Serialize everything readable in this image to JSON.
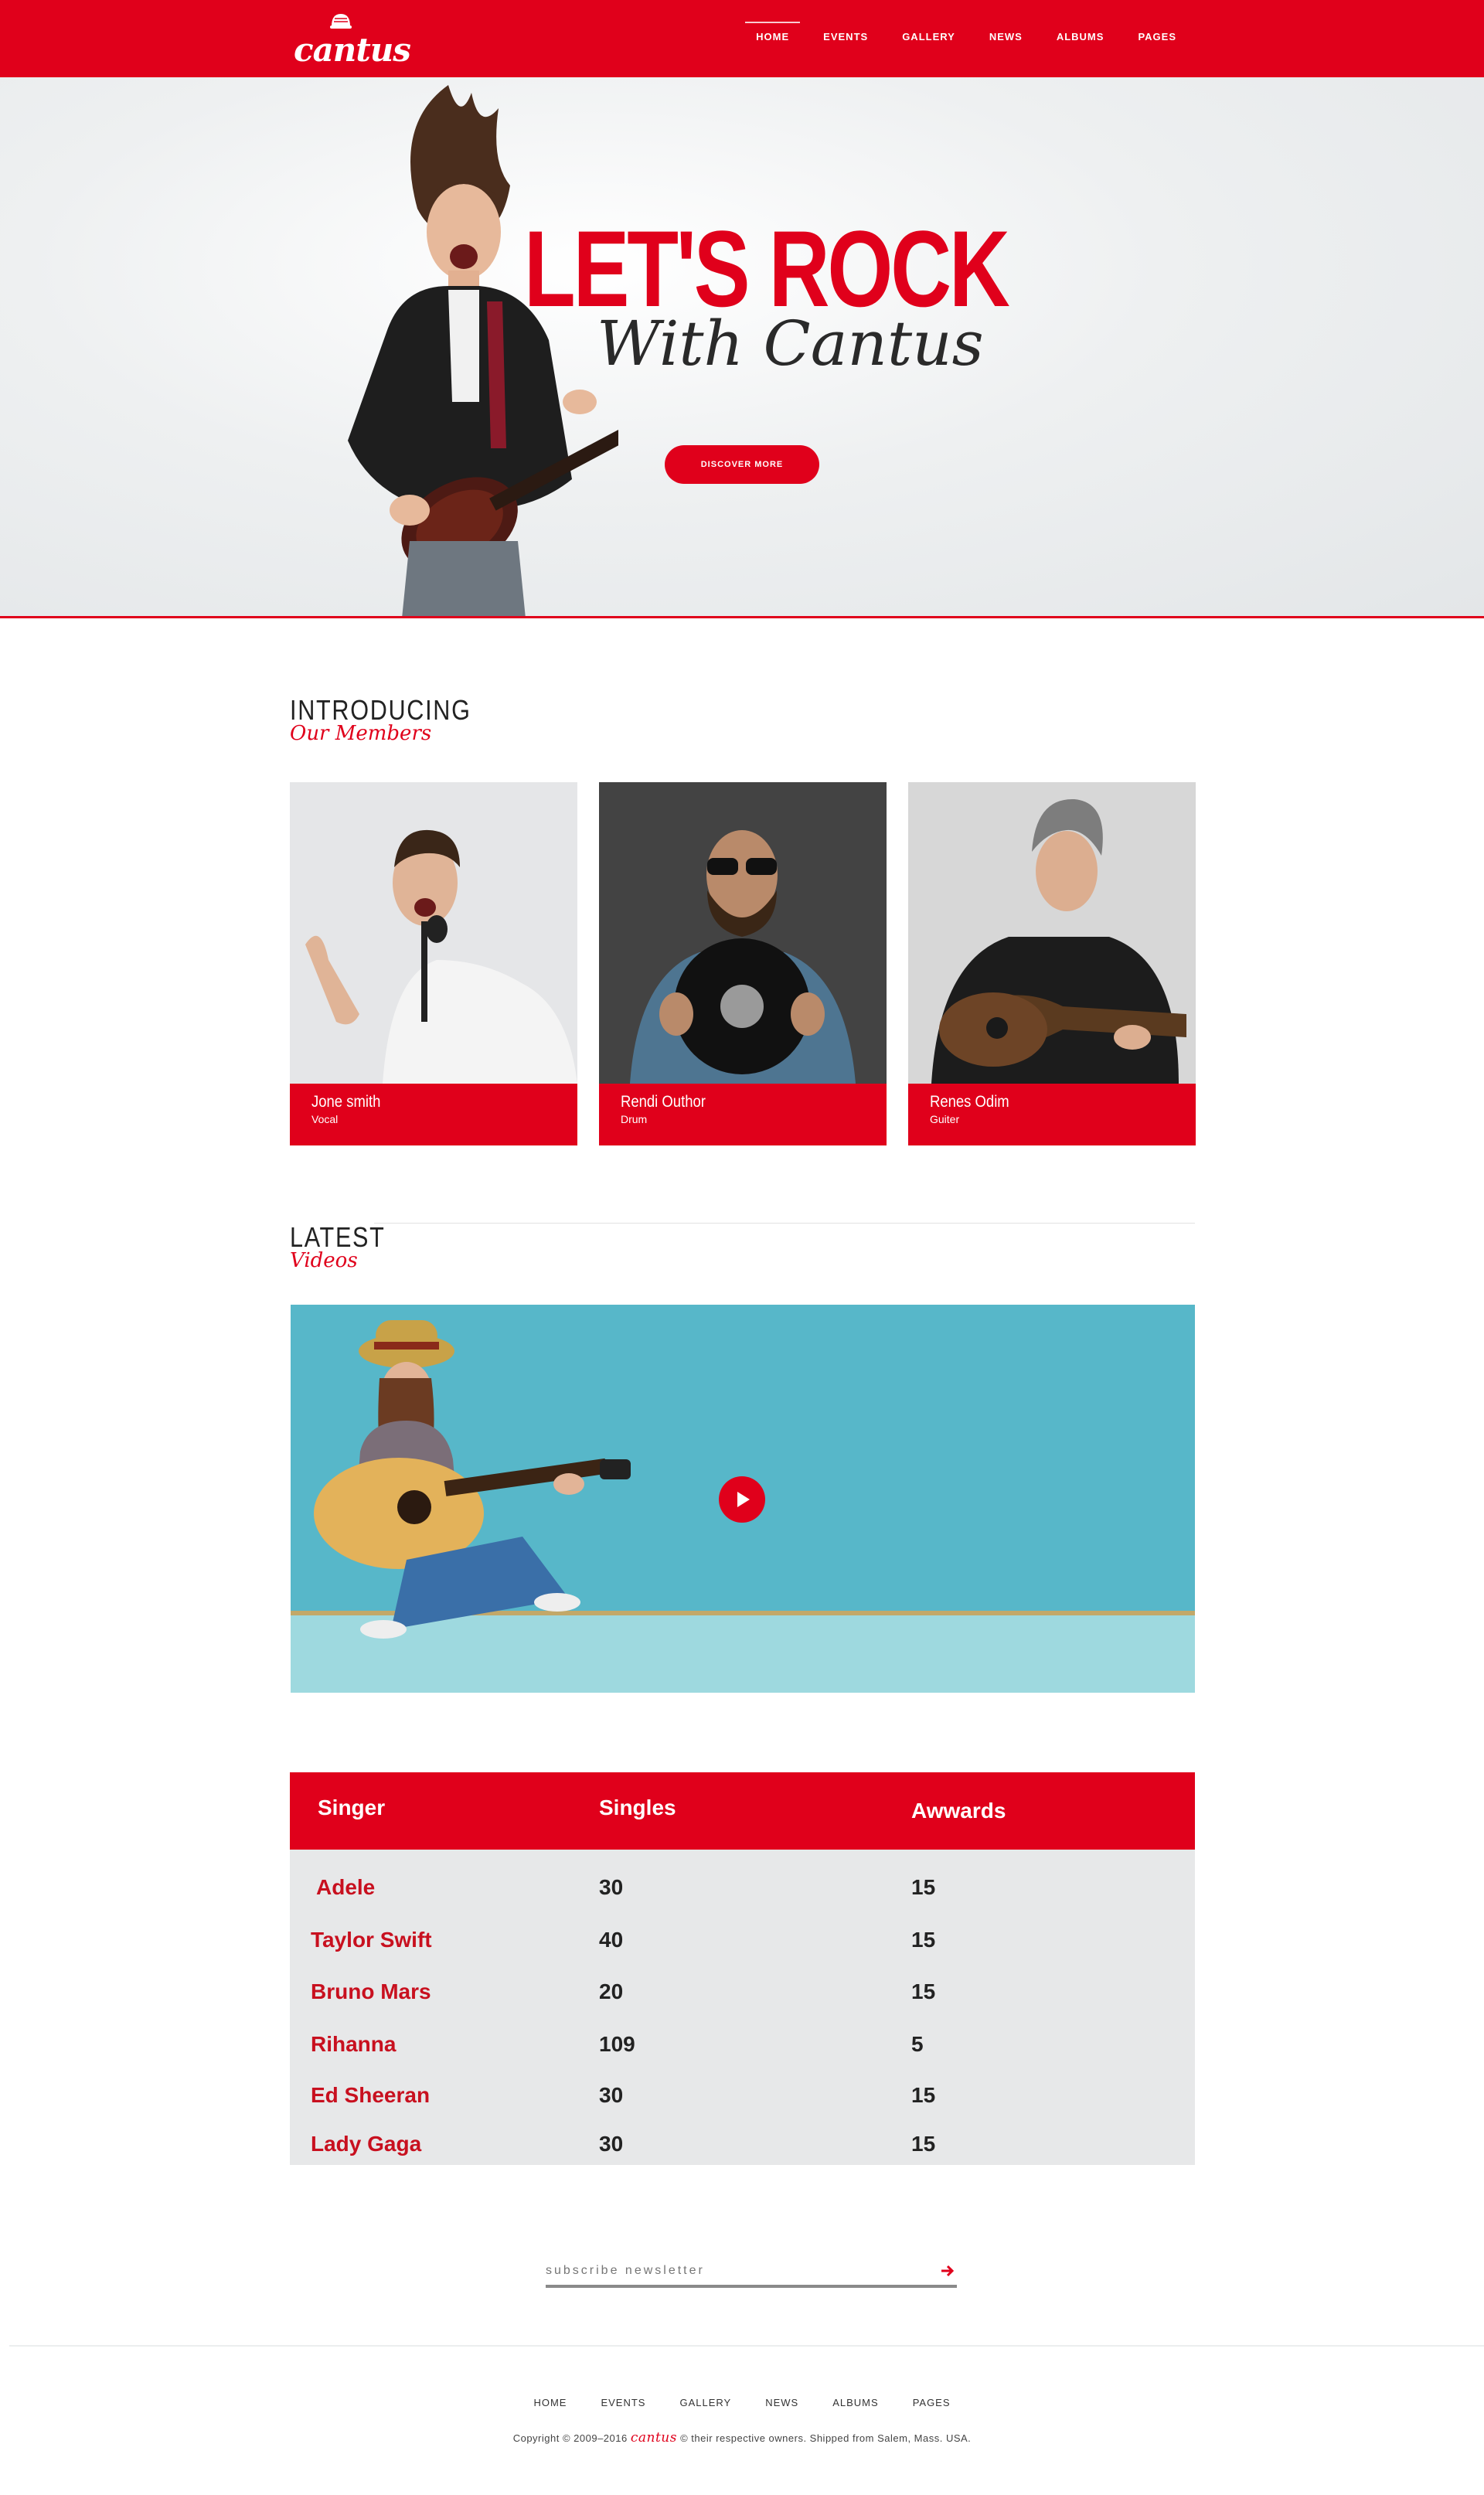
{
  "brand": {
    "logo_text": "cantus",
    "accent": "#e0001b"
  },
  "nav": {
    "items": [
      "HOME",
      "EVENTS",
      "GALLERY",
      "NEWS",
      "ALBUMS",
      "PAGES"
    ],
    "active": "HOME"
  },
  "hero": {
    "title": "LET'S ROCK",
    "subtitle": "With Cantus",
    "button": "DISCOVER MORE"
  },
  "members_section": {
    "title": "INTRODUCING",
    "subtitle": "Our Members",
    "members": [
      {
        "name": "Jone smith",
        "role": "Vocal"
      },
      {
        "name": "Rendi Outhor",
        "role": "Drum"
      },
      {
        "name": "Renes Odim",
        "role": "Guiter"
      }
    ]
  },
  "videos_section": {
    "title": "LATEST",
    "subtitle": "Videos"
  },
  "table": {
    "headers": [
      "Singer",
      "Singles",
      "Awwards"
    ],
    "rows": [
      [
        "Adele",
        "30",
        "15"
      ],
      [
        "Taylor Swift",
        "40",
        "15"
      ],
      [
        "Bruno Mars",
        "20",
        "15"
      ],
      [
        "Rihanna",
        "109",
        "5"
      ],
      [
        "Ed Sheeran",
        "30",
        "15"
      ],
      [
        "Lady Gaga",
        "30",
        "15"
      ]
    ]
  },
  "newsletter": {
    "placeholder": "subscribe newsletter"
  },
  "footer": {
    "nav": [
      "HOME",
      "EVENTS",
      "GALLERY",
      "NEWS",
      "ALBUMS",
      "PAGES"
    ],
    "copyright_pre": "Copyright © 2009–2016",
    "brand": "cantus",
    "copyright_post": "© their respective owners. Shipped from Salem, Mass. USA."
  }
}
